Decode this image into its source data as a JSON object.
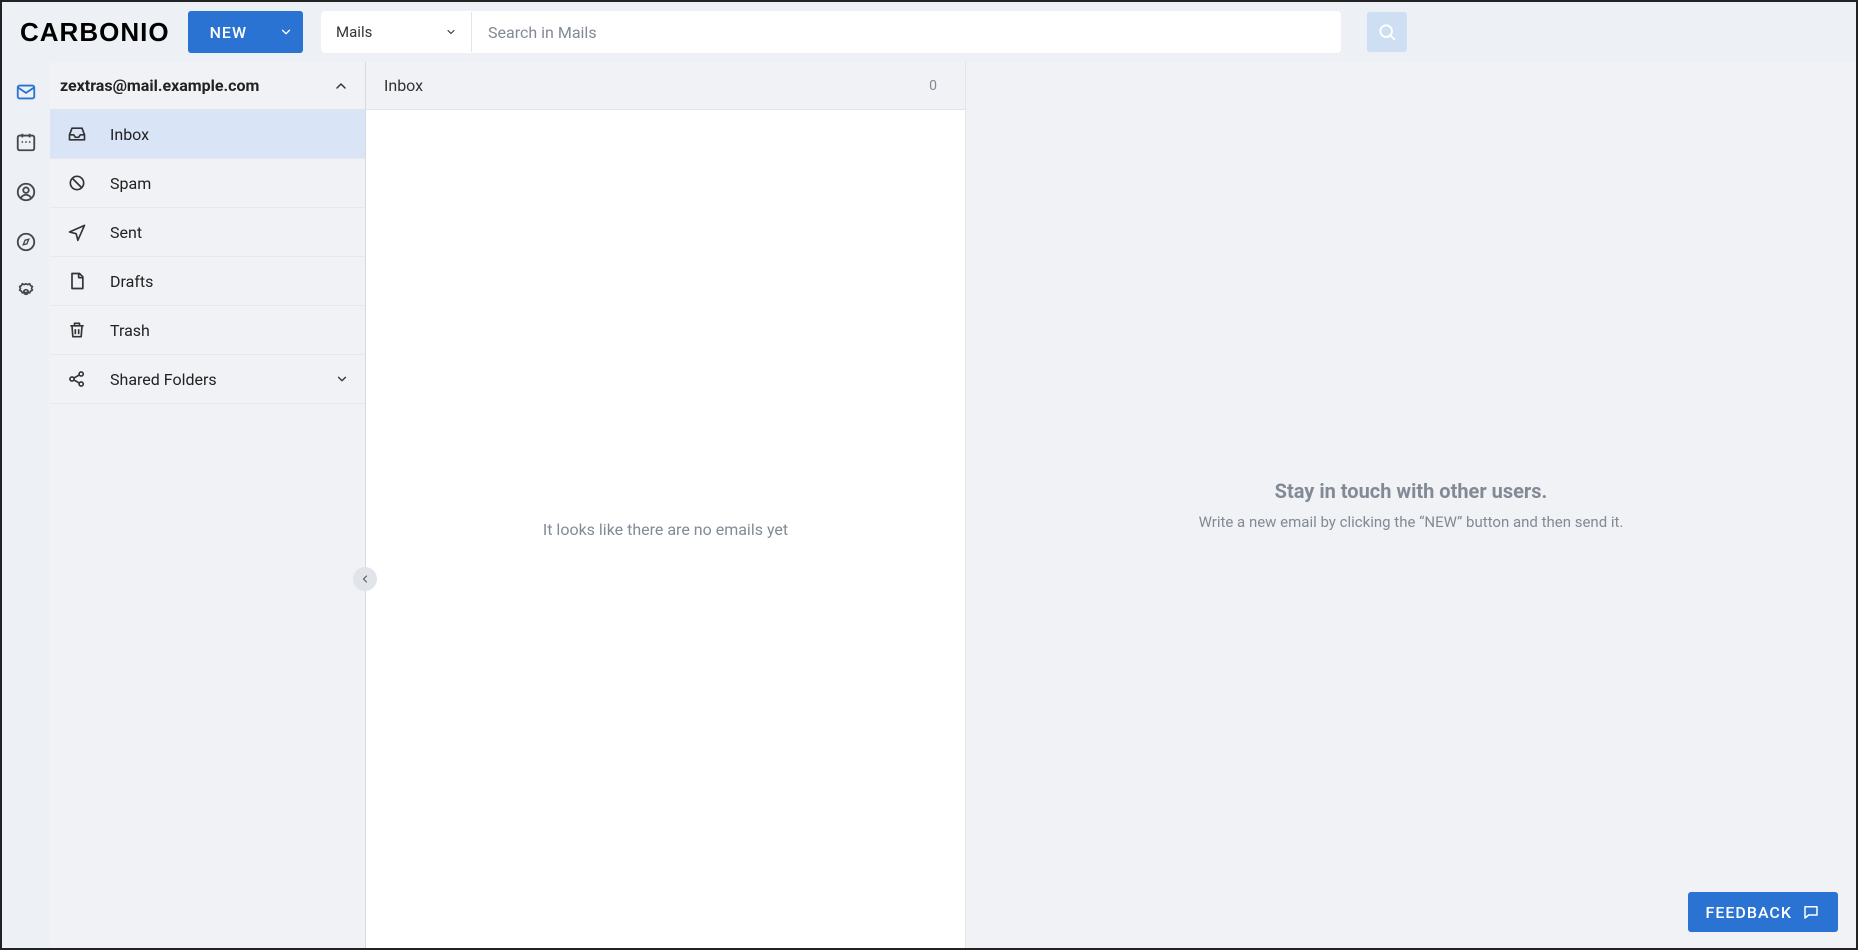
{
  "brand": {
    "name": "CARBONIO"
  },
  "topbar": {
    "new_label": "NEW",
    "search_scope": "Mails",
    "search_placeholder": "Search in Mails"
  },
  "sidebar": {
    "account_email": "zextras@mail.example.com",
    "folders": [
      {
        "label": "Inbox"
      },
      {
        "label": "Spam"
      },
      {
        "label": "Sent"
      },
      {
        "label": "Drafts"
      },
      {
        "label": "Trash"
      },
      {
        "label": "Shared Folders"
      }
    ]
  },
  "list": {
    "title": "Inbox",
    "count": "0",
    "empty_text": "It looks like there are no emails yet"
  },
  "detail": {
    "empty_title": "Stay in touch with other users.",
    "empty_subtitle": "Write a new email by clicking the “NEW” button and then send it."
  },
  "footer": {
    "feedback_label": "FEEDBACK"
  }
}
